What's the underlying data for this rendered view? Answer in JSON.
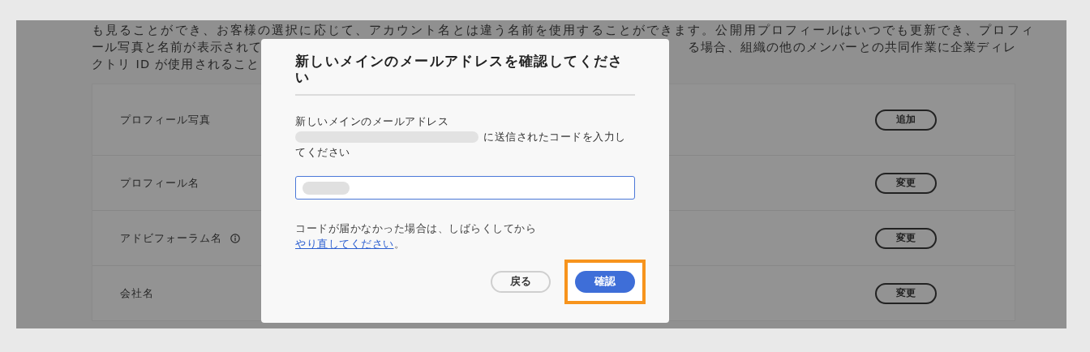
{
  "background": {
    "description_lines": [
      {
        "segments": [
          "も見ることができ、お客様の選択に応じて、アカウント名とは違う名前を使用することができます。公開用プロフィールはいつでも更新でき、プロフィ"
        ]
      },
      {
        "segments": [
          "ール写真と名前が表示されて",
          "る場合、組織の他のメンバーとの共同作業に企業ディレ"
        ]
      },
      {
        "segments": [
          "クトリ ID が使用されること"
        ]
      }
    ],
    "rows": [
      {
        "kind": "plain",
        "label": "プロフィール写真",
        "button": "追加"
      },
      {
        "kind": "plain",
        "label": "プロフィール名",
        "button": "変更"
      },
      {
        "kind": "with_info",
        "label": "アドビフォーラム名",
        "button": "変更"
      },
      {
        "kind": "plain",
        "label": "会社名",
        "button": "変更"
      }
    ]
  },
  "dialog": {
    "title": "新しいメインのメールアドレスを確認してください",
    "prompt": "新しいメインのメールアドレス",
    "prompt_after": [
      "に送信されたコードを入力し",
      "てください"
    ],
    "hint": "コードが届かなかった場合は、しばらくしてから",
    "hint_link": "やり直してください",
    "hint_end": "。",
    "buttons": [
      {
        "label": "戻る",
        "kind": "secondary",
        "highlighted": false
      },
      {
        "label": "確認",
        "kind": "primary",
        "highlighted": true
      }
    ]
  }
}
